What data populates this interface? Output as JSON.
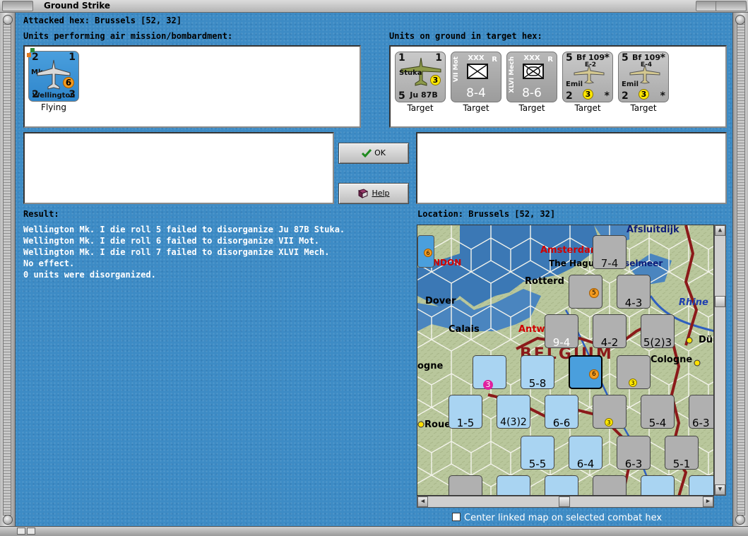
{
  "window": {
    "title": "Ground Strike"
  },
  "attacked_hex": "Attacked hex: Brussels  [52, 32]",
  "air_units_heading": "Units performing air mission/bombardment:",
  "ground_units_heading": "Units on ground in target hex:",
  "air_units": [
    {
      "name_top": "Mk. I",
      "name": "Wellington",
      "tl": "2",
      "tr": "1",
      "bl": "2",
      "br": "3",
      "badge": "6",
      "label": "Flying",
      "color": "blue"
    }
  ],
  "ground_units": [
    {
      "type": "air",
      "name": "Stuka",
      "model": "Ju 87B",
      "tl": "1",
      "tr": "1",
      "bl": "5",
      "badge": "3",
      "label": "Target"
    },
    {
      "type": "land",
      "side_name": "VII Mot",
      "size": "XXX",
      "reserve": "R",
      "value": "8-4",
      "label": "Target"
    },
    {
      "type": "land",
      "side_name": "XLVI Mech",
      "size": "XXX",
      "reserve": "R",
      "value": "8-6",
      "label": "Target"
    },
    {
      "type": "air",
      "name": "Bf 109",
      "variant": "E-2",
      "pilot": "Emil",
      "tl": "5",
      "tr": "*",
      "bl": "2",
      "br": "*",
      "badge": "3",
      "label": "Target"
    },
    {
      "type": "air",
      "name": "Bf 109",
      "variant": "E-4",
      "pilot": "Emil",
      "tl": "5",
      "tr": "*",
      "bl": "2",
      "br": "*",
      "badge": "3",
      "label": "Target"
    }
  ],
  "buttons": {
    "ok": "OK",
    "help": "Help"
  },
  "result": {
    "heading": "Result:",
    "lines": [
      "Wellington Mk. I die roll 5 failed to disorganize Ju 87B Stuka.",
      "Wellington Mk. I die roll 6 failed to disorganize VII Mot.",
      "Wellington Mk. I die roll 7 failed to disorganize XLVI Mech.",
      "No effect.",
      "0 units were disorganized."
    ]
  },
  "location": "Location:  Brussels  [52, 32]",
  "map": {
    "places": {
      "afsluitdijk": "Afsluitdijk",
      "amsterdam": "Amsterdam",
      "the_hague": "The Hague",
      "ijsselmeer": "sselmeer",
      "rotterdam": "Rotterd",
      "london": "NDON",
      "dover": "Dover",
      "calais": "Calais",
      "antwerp": "Antw",
      "rhine": "Rhine",
      "dusseldorf": "Dü",
      "belgium": "BELGIUM",
      "cologne": "Cologne",
      "boulogne": "ogne",
      "rouen": "Roue"
    },
    "stacks": [
      {
        "id": "s1",
        "val": "7-4",
        "num": "2"
      },
      {
        "id": "s2",
        "val": "4-3",
        "num": ""
      },
      {
        "id": "s3",
        "val": "9-4",
        "num": ""
      },
      {
        "id": "s4",
        "val": "4-2",
        "num": "2"
      },
      {
        "id": "s5",
        "val": "5(2)3",
        "num": ""
      },
      {
        "id": "s6",
        "val": "3",
        "num": "2"
      },
      {
        "id": "s7",
        "val": "5-8",
        "num": "3"
      },
      {
        "id": "s8",
        "val": "1-5",
        "num": ""
      },
      {
        "id": "s9",
        "val": "4(3)2",
        "num": ""
      },
      {
        "id": "s10",
        "val": "6-6",
        "num": "3"
      },
      {
        "id": "s11",
        "val": "5-4",
        "num": ""
      },
      {
        "id": "s12",
        "val": "6-3",
        "num": "2"
      },
      {
        "id": "s13",
        "val": "5-5",
        "num": ""
      },
      {
        "id": "s14",
        "val": "6-4",
        "num": ""
      },
      {
        "id": "s15",
        "val": "6-3",
        "num": "3"
      },
      {
        "id": "s16",
        "val": "5-1",
        "num": ""
      }
    ]
  },
  "center_linked_map_label": "Center linked map on selected combat hex",
  "colors": {
    "panel_blue": "#3d8bc5",
    "red_border": "#8b1a1a",
    "german_gray": "#b0b0b0",
    "allied_blue": "#5aa7e0"
  }
}
